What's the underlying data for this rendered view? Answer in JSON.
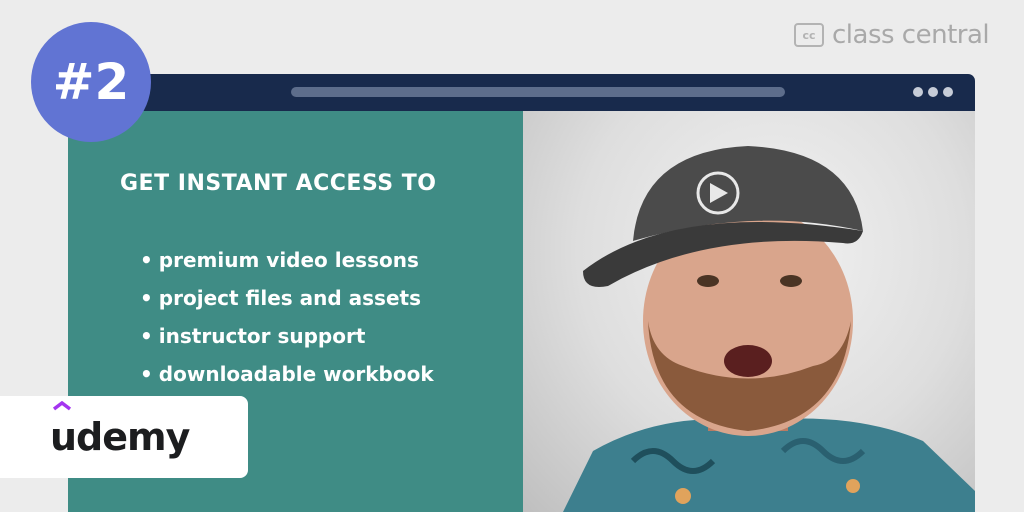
{
  "brand": {
    "icon": "cc-icon",
    "icon_text": "cc",
    "name": "class central"
  },
  "badge": {
    "text": "#2"
  },
  "window": {
    "heading": "GET INSTANT ACCESS TO",
    "bullets": [
      "premium video lessons",
      "project files and assets",
      "instructor support",
      "downloadable workbook"
    ],
    "bullet_glyph": "•"
  },
  "provider": {
    "name": "udemy",
    "accent": "#a435f0"
  },
  "colors": {
    "background": "#ececec",
    "titlebar": "#182a4c",
    "left_pane": "#3f8c85",
    "badge": "#6174d3"
  }
}
